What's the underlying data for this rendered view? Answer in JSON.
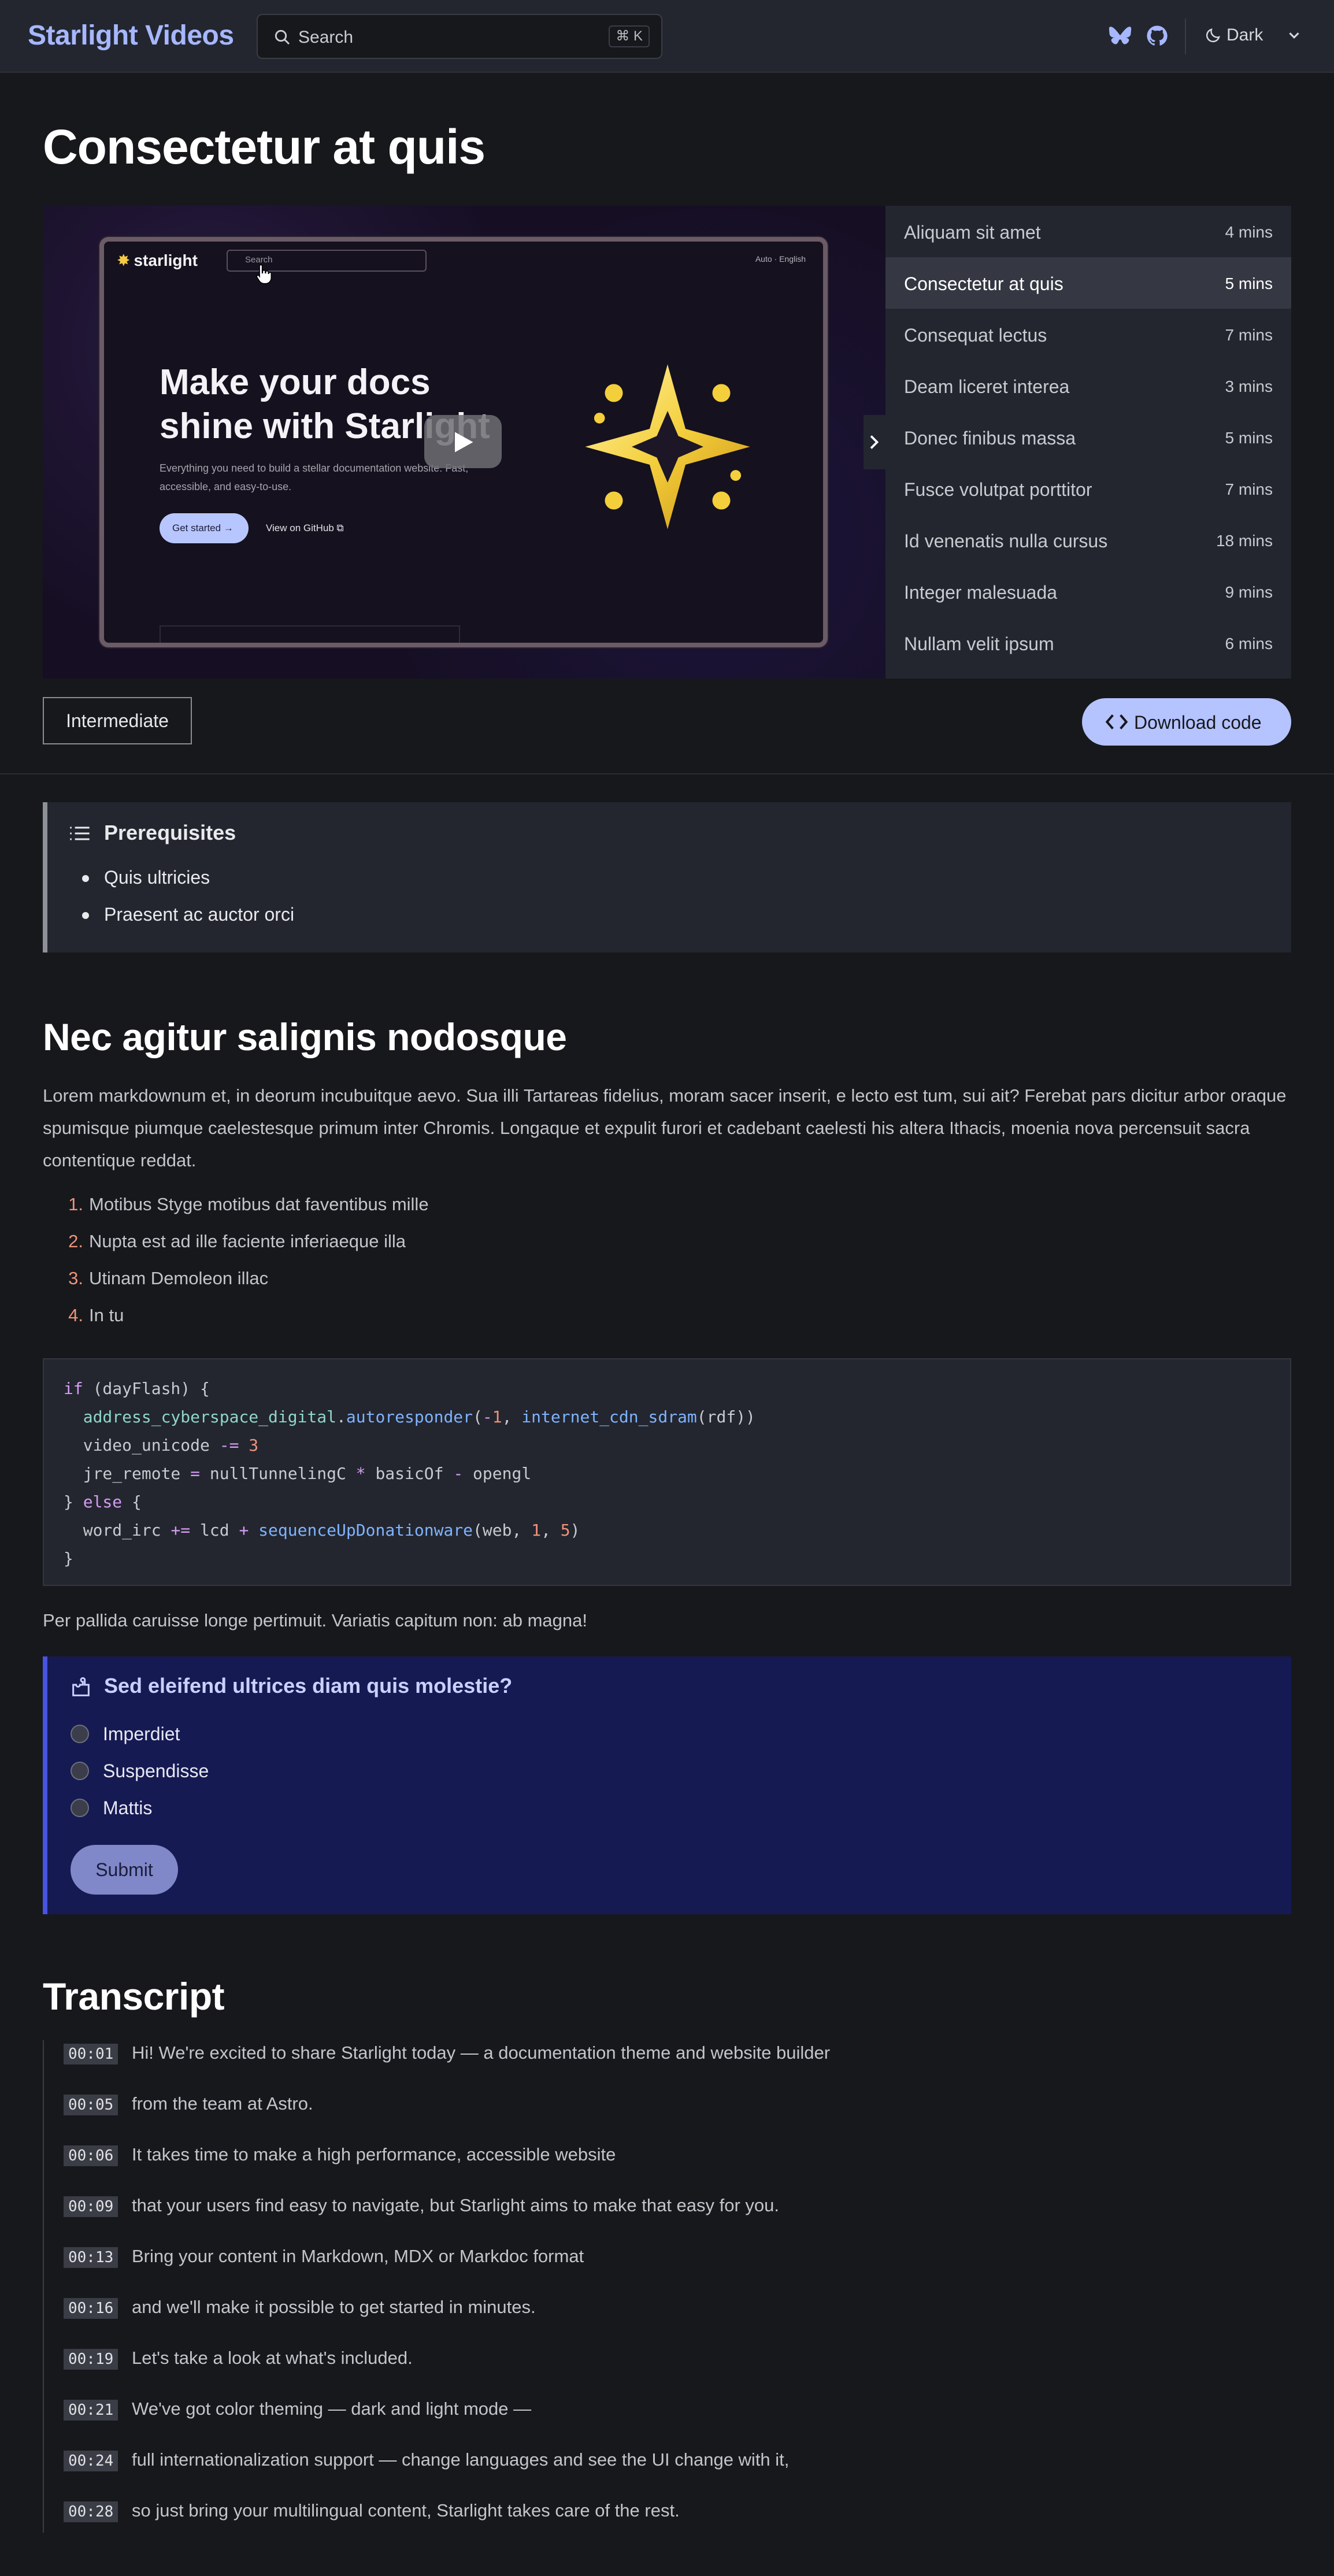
{
  "header": {
    "site_title": "Starlight Videos",
    "search_placeholder": "Search",
    "search_shortcut": "⌘ K",
    "icons": [
      "bluesky-icon",
      "github-icon"
    ],
    "theme_label": "Dark"
  },
  "page": {
    "title": "Consectetur at quis"
  },
  "video": {
    "screen": {
      "logo": "starlight",
      "search": "Search",
      "nav_right": "Auto   ·   English",
      "hero_title": "Make your docs shine with Starlight",
      "hero_text": "Everything you need to build a stellar documentation website. Fast, accessible, and easy-to-use.",
      "cta_primary": "Get started →",
      "cta_secondary": "View on GitHub ⧉"
    }
  },
  "chapters": [
    {
      "name": "Aliquam sit amet",
      "duration": "4 mins",
      "active": false
    },
    {
      "name": "Consectetur at quis",
      "duration": "5 mins",
      "active": true
    },
    {
      "name": "Consequat lectus",
      "duration": "7 mins",
      "active": false
    },
    {
      "name": "Deam liceret interea",
      "duration": "3 mins",
      "active": false
    },
    {
      "name": "Donec finibus massa",
      "duration": "5 mins",
      "active": false
    },
    {
      "name": "Fusce volutpat porttitor",
      "duration": "7 mins",
      "active": false
    },
    {
      "name": "Id venenatis nulla cursus",
      "duration": "18 mins",
      "active": false
    },
    {
      "name": "Integer malesuada",
      "duration": "9 mins",
      "active": false
    },
    {
      "name": "Nullam velit ipsum",
      "duration": "6 mins",
      "active": false
    }
  ],
  "meta": {
    "level": "Intermediate",
    "download_label": "Download code"
  },
  "prerequisites": {
    "title": "Prerequisites",
    "items": [
      "Quis ultricies",
      "Praesent ac auctor orci"
    ]
  },
  "article": {
    "heading": "Nec agitur salignis nodosque",
    "intro": "Lorem markdownum et, in deorum incubuitque aevo. Sua illi Tartareas fidelius, moram sacer inserit, e lecto est tum, sui ait? Ferebat pars dicitur arbor oraque spumisque piumque caelestesque primum inter Chromis. Longaque et expulit furori et cadebant caelesti his altera Ithacis, moenia nova percensuit sacra contentique reddat.",
    "list": [
      "Motibus Styge motibus dat faventibus mille",
      "Nupta est ad ille faciente inferiaeque illa",
      "Utinam Demoleon illac",
      "In tu"
    ],
    "after_code": "Per pallida caruisse longe pertimuit. Variatis capitum non: ab magna!"
  },
  "quiz": {
    "question": "Sed eleifend ultrices diam quis molestie?",
    "options": [
      "Imperdiet",
      "Suspendisse",
      "Mattis"
    ],
    "submit_label": "Submit"
  },
  "transcript": {
    "heading": "Transcript",
    "lines": [
      {
        "time": "00:01",
        "text": "Hi! We're excited to share Starlight today — a documentation theme and website builder"
      },
      {
        "time": "00:05",
        "text": "from the team at Astro."
      },
      {
        "time": "00:06",
        "text": "It takes time to make a high  performance, accessible website"
      },
      {
        "time": "00:09",
        "text": "that your users find easy to navigate,   but Starlight aims to make that easy for you."
      },
      {
        "time": "00:13",
        "text": "Bring your content in  Markdown, MDX or Markdoc format"
      },
      {
        "time": "00:16",
        "text": "and we'll make it possible  to get started in minutes."
      },
      {
        "time": "00:19",
        "text": "Let's take a look at what's included."
      },
      {
        "time": "00:21",
        "text": "We've got color theming — dark and light mode —"
      },
      {
        "time": "00:24",
        "text": "full internationalization support — change languages and see the UI change with it,"
      },
      {
        "time": "00:28",
        "text": "so just bring your multilingual content,  Starlight takes care of the rest."
      }
    ]
  },
  "colors": {
    "accent": "#a6b7ff",
    "button": "#b5c3ff",
    "quiz_bg": "#161a52",
    "quiz_border": "#4654e0"
  }
}
